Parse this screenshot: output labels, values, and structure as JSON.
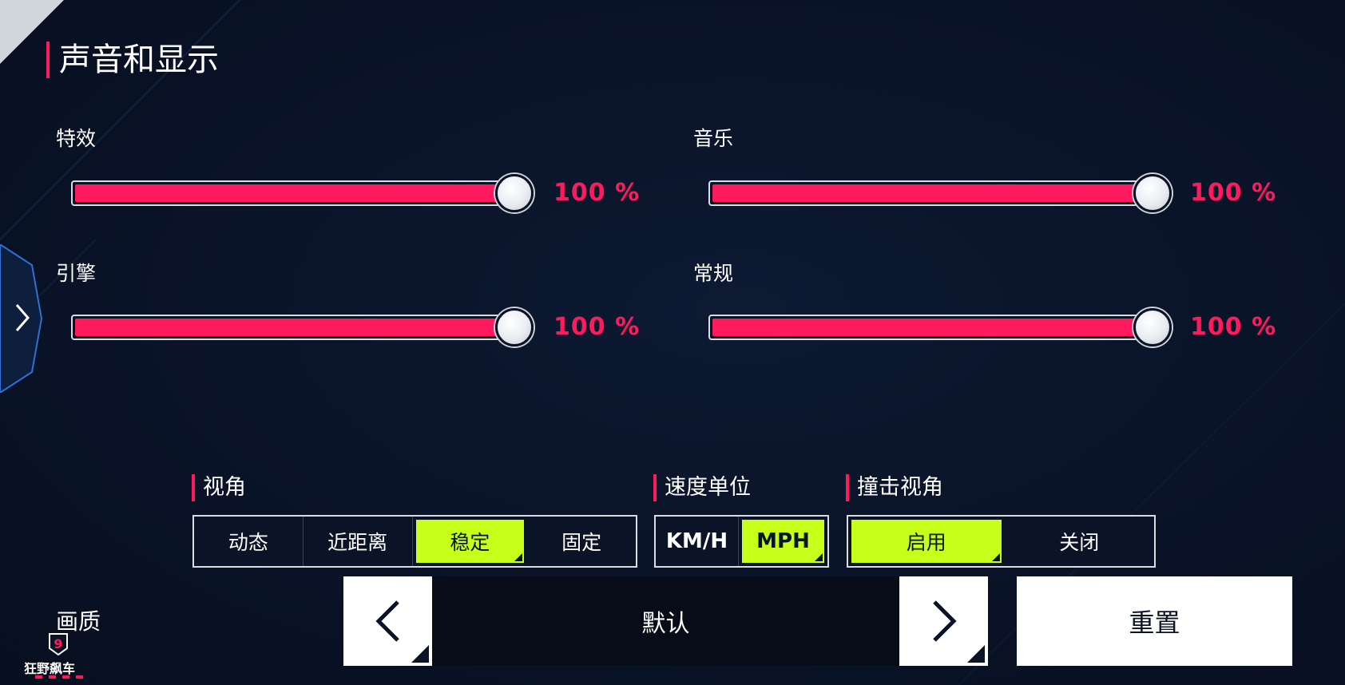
{
  "section_title": "声音和显示",
  "sliders": [
    {
      "label": "特效",
      "value": 100,
      "value_text": "100 %"
    },
    {
      "label": "音乐",
      "value": 100,
      "value_text": "100 %"
    },
    {
      "label": "引擎",
      "value": 100,
      "value_text": "100 %"
    },
    {
      "label": "常规",
      "value": 100,
      "value_text": "100 %"
    }
  ],
  "view_angle": {
    "title": "视角",
    "options": [
      "动态",
      "近距离",
      "稳定",
      "固定"
    ],
    "selected": "稳定"
  },
  "speed_unit": {
    "title": "速度单位",
    "options": [
      "KM/H",
      "MPH"
    ],
    "selected": "MPH"
  },
  "crash_view": {
    "title": "撞击视角",
    "options": [
      "启用",
      "关闭"
    ],
    "selected": "启用"
  },
  "quality": {
    "label": "画质",
    "value": "默认"
  },
  "reset_label": "重置",
  "logo_text": "狂野飙车",
  "logo_number": "9",
  "colors": {
    "accent": "#ff1a5e",
    "selected": "#c6ff1a",
    "background": "#0a1429"
  },
  "icons": {
    "side_tab": "chevron-right-icon",
    "quality_prev": "chevron-left-icon",
    "quality_next": "chevron-right-icon"
  }
}
